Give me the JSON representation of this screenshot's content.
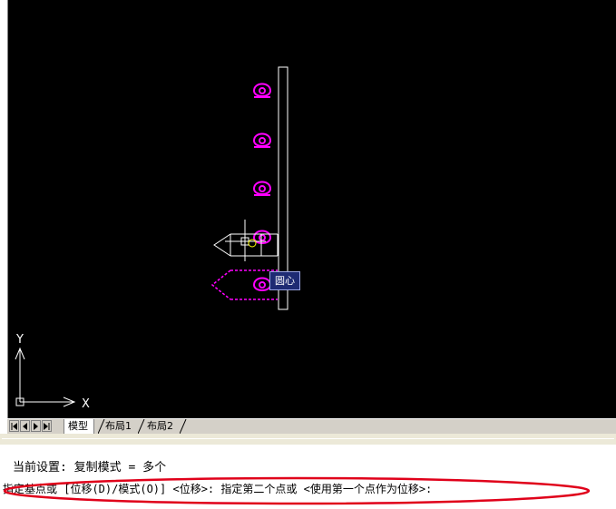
{
  "colors": {
    "canvas": "#000000",
    "magenta": "#ff00ff",
    "white": "#ffffff",
    "tooltip_bg": "#1e2b73",
    "annotation_red": "#e0001a"
  },
  "tooltip": {
    "label": "圆心"
  },
  "ucs": {
    "x_label": "X",
    "y_label": "Y"
  },
  "layout_tabs": [
    {
      "label": "模型",
      "active": true
    },
    {
      "label": "布局1",
      "active": false
    },
    {
      "label": "布局2",
      "active": false
    }
  ],
  "nav_buttons": [
    "first-icon",
    "prev-icon",
    "next-icon",
    "last-icon"
  ],
  "command": {
    "line1": "当前设置:  复制模式 = 多个",
    "line2": "指定基点或 [位移(D)/模式(O)] <位移>: 指定第二个点或 <使用第一个点作为位移>:"
  }
}
